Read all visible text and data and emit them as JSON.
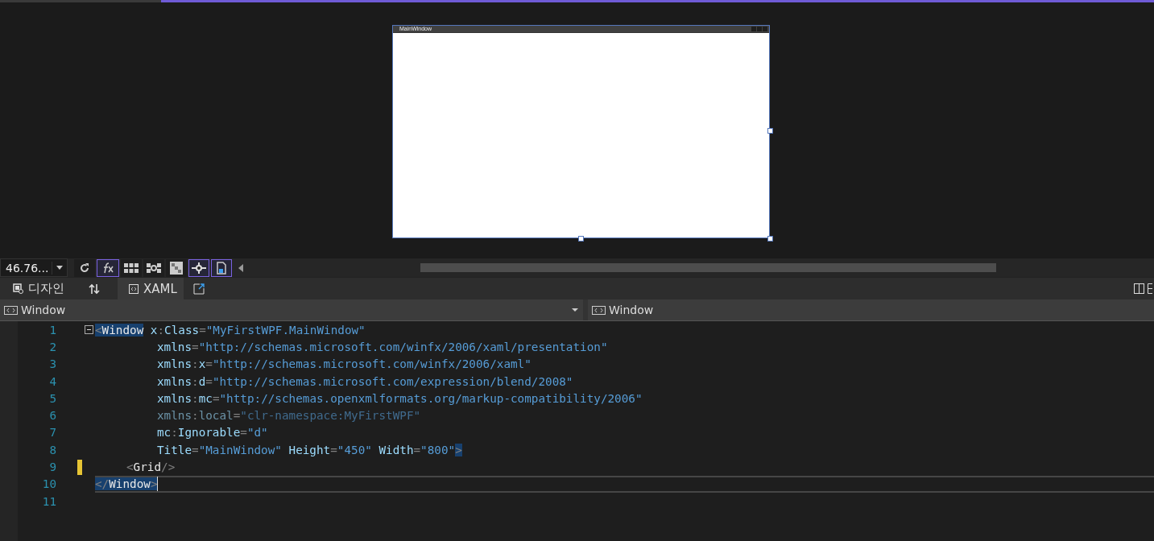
{
  "designer": {
    "window_title": "MainWindow"
  },
  "toolbar": {
    "zoom": "46.76...",
    "buttons": [
      {
        "kind": "refresh",
        "on": false
      },
      {
        "kind": "fx",
        "on": true
      },
      {
        "kind": "grid",
        "on": false
      },
      {
        "kind": "snap-grid",
        "on": false
      },
      {
        "kind": "checker",
        "on": false
      },
      {
        "kind": "snap-lines",
        "on": true
      },
      {
        "kind": "project-code",
        "on": true
      }
    ]
  },
  "tabs": [
    {
      "label": "디자인",
      "kind": "design",
      "selected": false
    },
    {
      "label": "XAML",
      "kind": "xaml",
      "selected": true
    }
  ],
  "nav": {
    "left": "Window",
    "right": "Window"
  },
  "editor": {
    "lines": [
      {
        "number": "1",
        "kind": "open",
        "changed": false,
        "current": false,
        "tokens": [
          {
            "kind": "delim-match",
            "text": "<"
          },
          {
            "kind": "tag-match",
            "text": "Window"
          },
          {
            "kind": "attr",
            "text": "x",
            "spaced": true
          },
          {
            "kind": "delim",
            "text": ":"
          },
          {
            "kind": "attr",
            "text": "Class"
          },
          {
            "kind": "delim",
            "text": "="
          },
          {
            "kind": "value",
            "text": "\"MyFirstWPF.MainWindow\""
          }
        ]
      },
      {
        "number": "2",
        "kind": "attribute",
        "changed": false,
        "current": false,
        "tokens": [
          {
            "kind": "attr",
            "text": "xmlns"
          },
          {
            "kind": "delim",
            "text": "="
          },
          {
            "kind": "value",
            "text": "\"http://schemas.microsoft.com/winfx/2006/xaml/presentation\""
          }
        ]
      },
      {
        "number": "3",
        "kind": "attribute",
        "changed": false,
        "current": false,
        "tokens": [
          {
            "kind": "attr",
            "text": "xmlns"
          },
          {
            "kind": "delim",
            "text": ":"
          },
          {
            "kind": "attr",
            "text": "x"
          },
          {
            "kind": "delim",
            "text": "="
          },
          {
            "kind": "value",
            "text": "\"http://schemas.microsoft.com/winfx/2006/xaml\""
          }
        ]
      },
      {
        "number": "4",
        "kind": "attribute",
        "changed": false,
        "current": false,
        "tokens": [
          {
            "kind": "attr",
            "text": "xmlns"
          },
          {
            "kind": "delim",
            "text": ":"
          },
          {
            "kind": "attr",
            "text": "d"
          },
          {
            "kind": "delim",
            "text": "="
          },
          {
            "kind": "value",
            "text": "\"http://schemas.microsoft.com/expression/blend/2008\""
          }
        ]
      },
      {
        "number": "5",
        "kind": "attribute",
        "changed": false,
        "current": false,
        "tokens": [
          {
            "kind": "attr",
            "text": "xmlns"
          },
          {
            "kind": "delim",
            "text": ":"
          },
          {
            "kind": "attr",
            "text": "mc"
          },
          {
            "kind": "delim",
            "text": "="
          },
          {
            "kind": "value",
            "text": "\"http://schemas.openxmlformats.org/markup-compatibility/2006\""
          }
        ]
      },
      {
        "number": "6",
        "kind": "attribute",
        "changed": false,
        "current": false,
        "tokens": [
          {
            "kind": "attr-dim",
            "text": "xmlns"
          },
          {
            "kind": "delim",
            "text": ":"
          },
          {
            "kind": "attr-dim",
            "text": "local"
          },
          {
            "kind": "delim",
            "text": "="
          },
          {
            "kind": "value-dim",
            "text": "\"clr-namespace:MyFirstWPF\""
          }
        ]
      },
      {
        "number": "7",
        "kind": "attribute",
        "changed": false,
        "current": false,
        "tokens": [
          {
            "kind": "attr",
            "text": "mc"
          },
          {
            "kind": "delim",
            "text": ":"
          },
          {
            "kind": "attr",
            "text": "Ignorable"
          },
          {
            "kind": "delim",
            "text": "="
          },
          {
            "kind": "value",
            "text": "\"d\""
          }
        ]
      },
      {
        "number": "8",
        "kind": "attribute",
        "changed": false,
        "current": false,
        "tokens": [
          {
            "kind": "attr",
            "text": "Title"
          },
          {
            "kind": "delim",
            "text": "="
          },
          {
            "kind": "value",
            "text": "\"MainWindow\""
          },
          {
            "kind": "attr",
            "text": "Height",
            "spaced": true
          },
          {
            "kind": "delim",
            "text": "="
          },
          {
            "kind": "value",
            "text": "\"450\""
          },
          {
            "kind": "attr",
            "text": "Width",
            "spaced": true
          },
          {
            "kind": "delim",
            "text": "="
          },
          {
            "kind": "value",
            "text": "\"800\""
          },
          {
            "kind": "delim-match",
            "text": ">"
          }
        ]
      },
      {
        "number": "9",
        "kind": "child",
        "changed": true,
        "current": false,
        "tokens": [
          {
            "kind": "delim",
            "text": "<"
          },
          {
            "kind": "tag",
            "text": "Grid"
          },
          {
            "kind": "delim",
            "text": "/>"
          }
        ]
      },
      {
        "number": "10",
        "kind": "close",
        "changed": false,
        "current": true,
        "tokens": [
          {
            "kind": "delim-match",
            "text": "</"
          },
          {
            "kind": "tag-match",
            "text": "Window"
          },
          {
            "kind": "delim-match",
            "text": ">"
          }
        ]
      },
      {
        "number": "11",
        "kind": "blank",
        "changed": false,
        "current": false
      }
    ]
  }
}
